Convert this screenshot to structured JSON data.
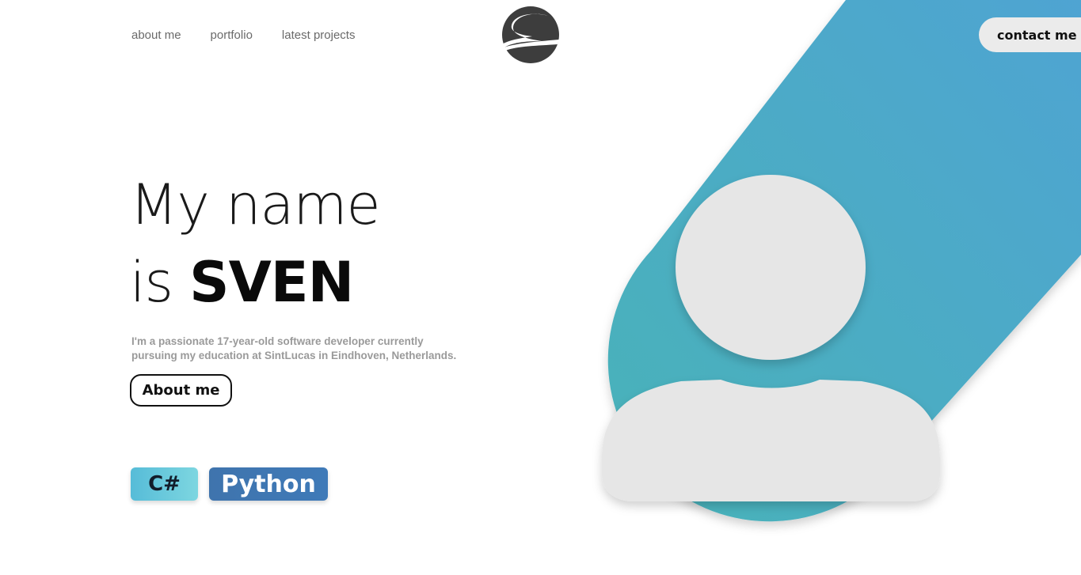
{
  "nav": {
    "links": [
      "about me",
      "portfolio",
      "latest projects"
    ],
    "contact_label": "contact me"
  },
  "hero": {
    "line1": "My name",
    "line2_prefix": "is ",
    "name": "SVEN",
    "intro": "I'm a passionate 17-year-old software developer currently pursuing my education at SintLucas in Eindhoven, Netherlands.",
    "about_button": "About me"
  },
  "skills": [
    "C#",
    "Python"
  ],
  "icons": {
    "logo": "s-logo-icon",
    "avatar": "user-avatar-icon"
  },
  "colors": {
    "accent_band_start": "#4db3b9",
    "accent_band_end": "#4fa5d0",
    "avatar_fill": "#e6e6e6",
    "logo_fill": "#3d3d3d",
    "csharp_chip": "#63c7dc",
    "python_chip": "#3f76b1"
  }
}
